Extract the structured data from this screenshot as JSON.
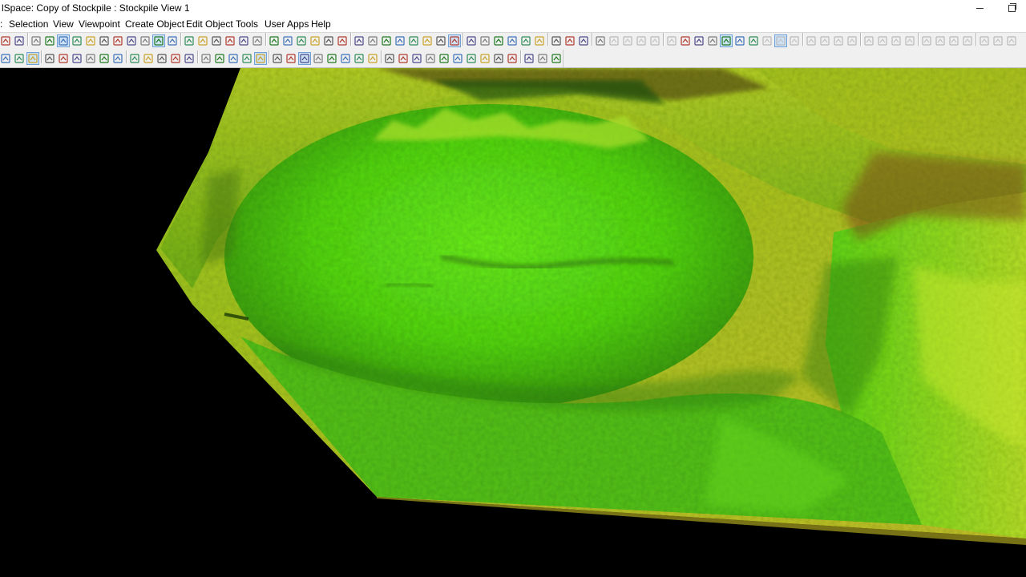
{
  "window": {
    "title": "lSpace: Copy of Stockpile : Stockpile View 1",
    "minimize_label": "minimize",
    "maximize_label": "restore"
  },
  "menu": {
    "items": [
      {
        "name": "menu-item-file",
        "label": ":"
      },
      {
        "name": "menu-item-selection",
        "label": "Selection"
      },
      {
        "name": "menu-item-view",
        "label": "View"
      },
      {
        "name": "menu-item-viewpoint",
        "label": "Viewpoint"
      },
      {
        "name": "menu-item-create-object",
        "label": "Create Object"
      },
      {
        "name": "menu-item-edit-object",
        "label": "Edit Object"
      },
      {
        "name": "menu-item-tools",
        "label": "Tools"
      },
      {
        "name": "menu-item-user-apps",
        "label": "User Apps"
      },
      {
        "name": "menu-item-help",
        "label": "Help"
      }
    ]
  },
  "colors": {
    "surface_bright": "#5fe81a",
    "surface_yellow": "#c8e023",
    "surface_dark": "#3a8a10",
    "surface_brown": "#8a5a1c",
    "background": "#000000",
    "toolbar_bg": "#f0f0f0"
  },
  "viewport": {
    "name": "stockpile-3d-view",
    "content": "3d-terrain-surface"
  }
}
